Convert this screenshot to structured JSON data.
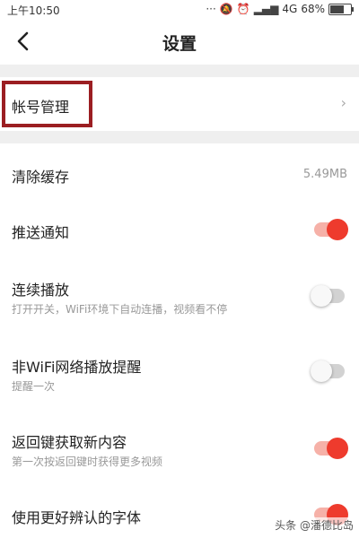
{
  "status_bar": {
    "time": "上午10:50",
    "network": "4G",
    "battery": "68%",
    "battery_level": 0.68
  },
  "header": {
    "title": "设置",
    "back_icon": "chevron-left-icon"
  },
  "account_row": {
    "label": "帐号管理",
    "chevron": "›"
  },
  "settings": {
    "clear_cache": {
      "label": "清除缓存",
      "value": "5.49MB"
    },
    "push_notify": {
      "label": "推送通知",
      "on": true
    },
    "continuous_play": {
      "label": "连续播放",
      "sub": "打开开关，WiFi环境下自动连播，视频看不停",
      "on": false
    },
    "non_wifi_alert": {
      "label": "非WiFi网络播放提醒",
      "sub": "提醒一次",
      "on": false
    },
    "back_refresh": {
      "label": "返回键获取新内容",
      "sub": "第一次按返回键时获得更多视频",
      "on": true
    },
    "readable_font": {
      "label": "使用更好辨认的字体",
      "on": true
    }
  },
  "colors": {
    "accent": "#ee3b2d",
    "highlight_border": "#9b1e22",
    "section_gap": "#efefef"
  },
  "watermark": "头条 @潘德比岛"
}
